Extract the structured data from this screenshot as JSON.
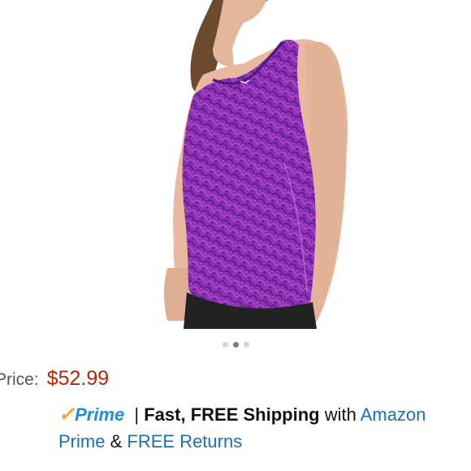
{
  "gallery": {
    "image_alt": "purple printed tank top",
    "dots": [
      false,
      true,
      false
    ]
  },
  "price": {
    "label": "Price:",
    "value": "$52.99"
  },
  "shipping": {
    "prime_check": "✓",
    "prime_text": "Prime",
    "separator": "|",
    "fast_free": "Fast, FREE Shipping",
    "with_text": "with",
    "amazon_prime_link": "Amazon Prime",
    "ampersand": "&",
    "free_returns_link": "FREE Returns"
  },
  "colors": {
    "price": "#b12704",
    "link": "#1a6fb5",
    "prime_blue": "#1f8ed8",
    "prime_check": "#f7a414",
    "garment": "#8e2fb4"
  }
}
